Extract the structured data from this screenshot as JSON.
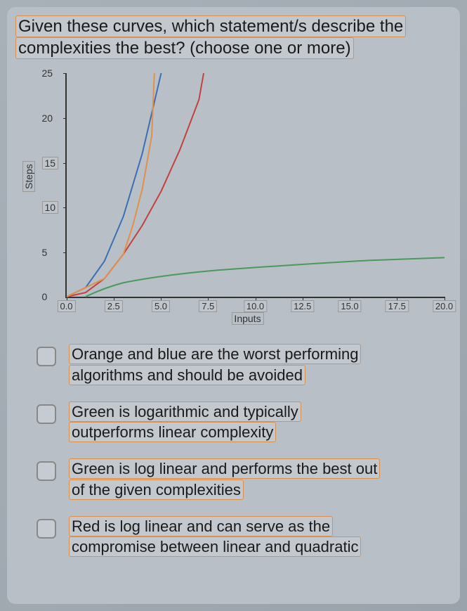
{
  "question": {
    "line1": "Given these curves, which statement/s describe the",
    "line2": "complexities the best? (choose one or more)"
  },
  "chart_data": {
    "type": "line",
    "xlabel": "Inputs",
    "ylabel": "Steps",
    "xlim": [
      0,
      20
    ],
    "ylim": [
      0,
      25
    ],
    "x_ticks": [
      "0.0",
      "2.5",
      "5.0",
      "7.5",
      "10.0",
      "12.5",
      "15.0",
      "17.5",
      "20.0"
    ],
    "y_ticks": [
      "0",
      "5",
      "10",
      "15",
      "20",
      "25"
    ],
    "series": [
      {
        "name": "blue",
        "color": "#3b6fb5",
        "x": [
          0,
          1,
          2,
          3,
          4,
          5
        ],
        "y": [
          0,
          1,
          4,
          9,
          16,
          25
        ]
      },
      {
        "name": "orange",
        "color": "#e0904a",
        "x": [
          0,
          1,
          2,
          3,
          3.5,
          4,
          4.5,
          4.64
        ],
        "y": [
          0,
          1,
          2,
          4.75,
          8,
          12,
          18,
          25
        ]
      },
      {
        "name": "green",
        "color": "#4a9a5a",
        "x": [
          1,
          2,
          3,
          5,
          8,
          12,
          16,
          20
        ],
        "y": [
          0,
          1,
          1.6,
          2.4,
          3.0,
          3.6,
          4.05,
          4.35
        ]
      },
      {
        "name": "red",
        "color": "#c44040",
        "x": [
          0,
          1,
          2,
          3,
          4,
          5,
          6,
          7,
          7.25
        ],
        "y": [
          0,
          0.5,
          2,
          4.75,
          8,
          11.8,
          16.5,
          22,
          25
        ]
      }
    ]
  },
  "options": [
    {
      "text_a": "Orange and blue are the worst performing",
      "text_b": "algorithms and should be avoided"
    },
    {
      "text_a": "Green is logarithmic and typically",
      "text_b": "outperforms linear complexity"
    },
    {
      "text_a": "Green is log linear and performs the best out",
      "text_b": "of the given complexities"
    },
    {
      "text_a": "Red is log linear and can serve as the",
      "text_b": "compromise between linear and quadratic"
    }
  ]
}
